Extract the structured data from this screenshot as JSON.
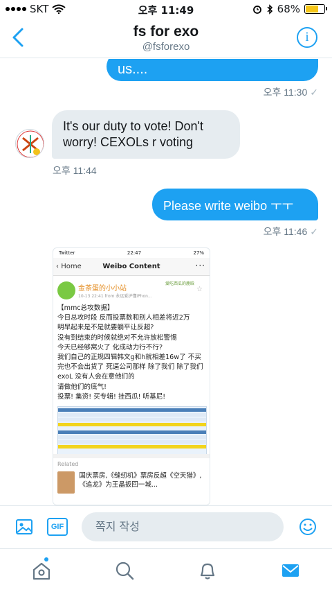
{
  "status_bar": {
    "carrier": "SKT",
    "time": "오후 11:49",
    "battery": "68%",
    "battery_level": 0.68
  },
  "header": {
    "title": "fs for exo",
    "handle": "@fsforexo"
  },
  "messages": [
    {
      "direction": "outgoing",
      "text": "us....",
      "time": "오후 11:30",
      "read": "✓"
    },
    {
      "direction": "incoming",
      "text": "It's our duty to vote! Don't worry! CEXOLs r voting",
      "time": "오후 11:44"
    },
    {
      "direction": "outgoing",
      "text": "Please write weibo ㅜㅜ",
      "time": "오후 11:46",
      "read": "✓"
    }
  ],
  "image_message": {
    "status_carrier": "Twitter",
    "status_time": "22:47",
    "status_battery": "27%",
    "nav_back": "Home",
    "nav_title": "Weibo Content",
    "nav_more": "···",
    "author_name": "金茶蛋的小小站",
    "author_meta": "10-13 22:41  from 永远爱护懂iPhon...",
    "author_tag": "爱吃西瓜的鹿晗",
    "post_text": "【mmc总攻数据】\n今日总攻时段 反而投票数和别人相差将近2万\n明早起来是不是就要躺平让反超?\n没有到结束的时候就绝对不允许放松警惕\n今天已经够窝火了 化成动力行不行?\n我们自己的正规四辑韩文g和h就相差16w了 不买完也不会出货了 死逼公司那样 除了我们 除了我们exoL 没有人会在意他们的\n请做他们的底气!\n投票! 集资! 买专辑! 挂西瓜! 听基尼!",
    "related_label": "Related",
    "related_text": "国庆票房,《缝纫机》票房反超《空天猎》,《追龙》为王晶扳回一城..."
  },
  "compose": {
    "gif_label": "GIF",
    "placeholder": "쪽지 작성"
  },
  "colors": {
    "accent": "#1da1f2",
    "incoming_bubble": "#e6ecf0",
    "battery_fill": "#f5c518"
  },
  "icons": [
    "back-chevron-icon",
    "info-icon",
    "media-icon",
    "gif-icon",
    "emoji-icon",
    "home-icon",
    "search-icon",
    "notifications-icon",
    "messages-icon"
  ]
}
